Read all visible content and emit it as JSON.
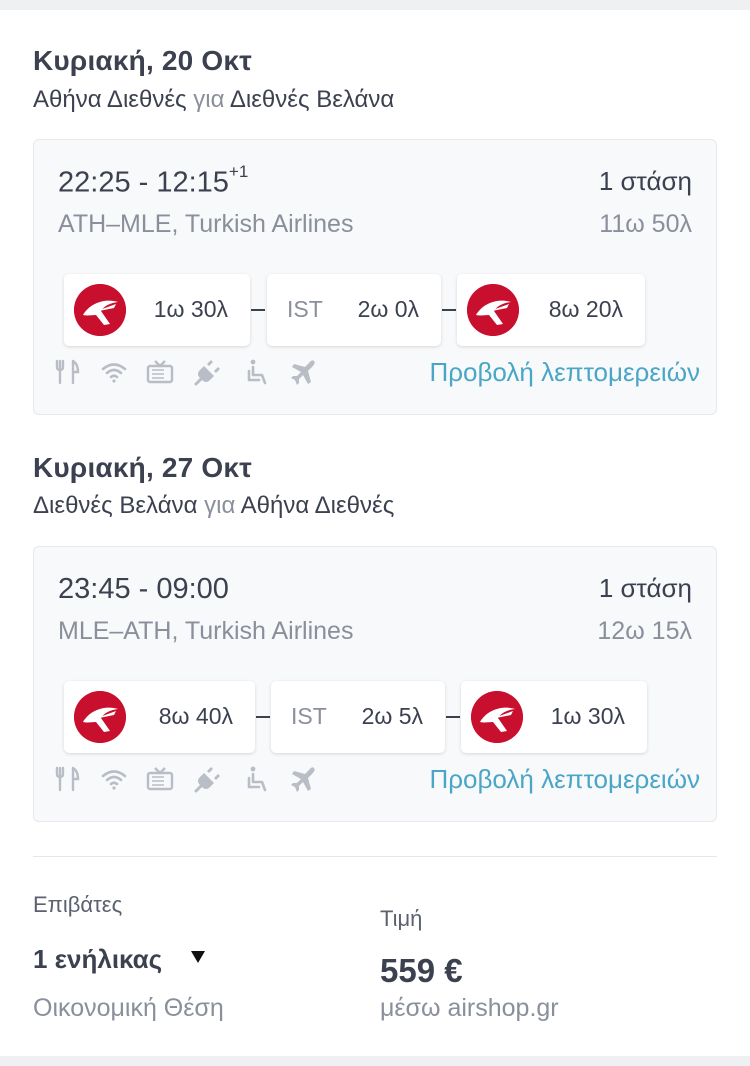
{
  "outbound": {
    "date": "Κυριακή, 20 Οκτ",
    "from": "Αθήνα Διεθνές",
    "connector": "για",
    "to": "Διεθνές Βελάνα",
    "times": "22:25 - 12:15",
    "day_offset": "+1",
    "stops": "1 στάση",
    "route_airline": "ATH–MLE, Turkish Airlines",
    "duration": "11ω 50λ",
    "segments": [
      {
        "duration": "1ω 30λ"
      },
      {
        "layover_airport": "IST",
        "layover_duration": "2ω 0λ"
      },
      {
        "duration": "8ω 20λ"
      }
    ],
    "details_link": "Προβολή λεπτομερειών"
  },
  "return": {
    "date": "Κυριακή, 27 Οκτ",
    "from": "Διεθνές Βελάνα",
    "connector": "για",
    "to": "Αθήνα Διεθνές",
    "times": "23:45 - 09:00",
    "stops": "1 στάση",
    "route_airline": "MLE–ATH, Turkish Airlines",
    "duration": "12ω 15λ",
    "segments": [
      {
        "duration": "8ω 40λ"
      },
      {
        "layover_airport": "IST",
        "layover_duration": "2ω 5λ"
      },
      {
        "duration": "1ω 30λ"
      }
    ],
    "details_link": "Προβολή λεπτομερειών"
  },
  "amenity_icons": [
    "meal-icon",
    "wifi-icon",
    "tv-icon",
    "power-icon",
    "accessibility-icon",
    "plane-icon"
  ],
  "booking": {
    "passengers_label": "Επιβάτες",
    "passengers_value": "1 ενήλικας",
    "cabin_class": "Οικονομική Θέση",
    "price_label": "Τιμή",
    "price": "559 €",
    "price_source": "μέσω airshop.gr"
  },
  "colors": {
    "link": "#4aa6c7",
    "airline_logo": "#c8102e",
    "text": "#3c4150",
    "muted": "#8a8f9c"
  }
}
